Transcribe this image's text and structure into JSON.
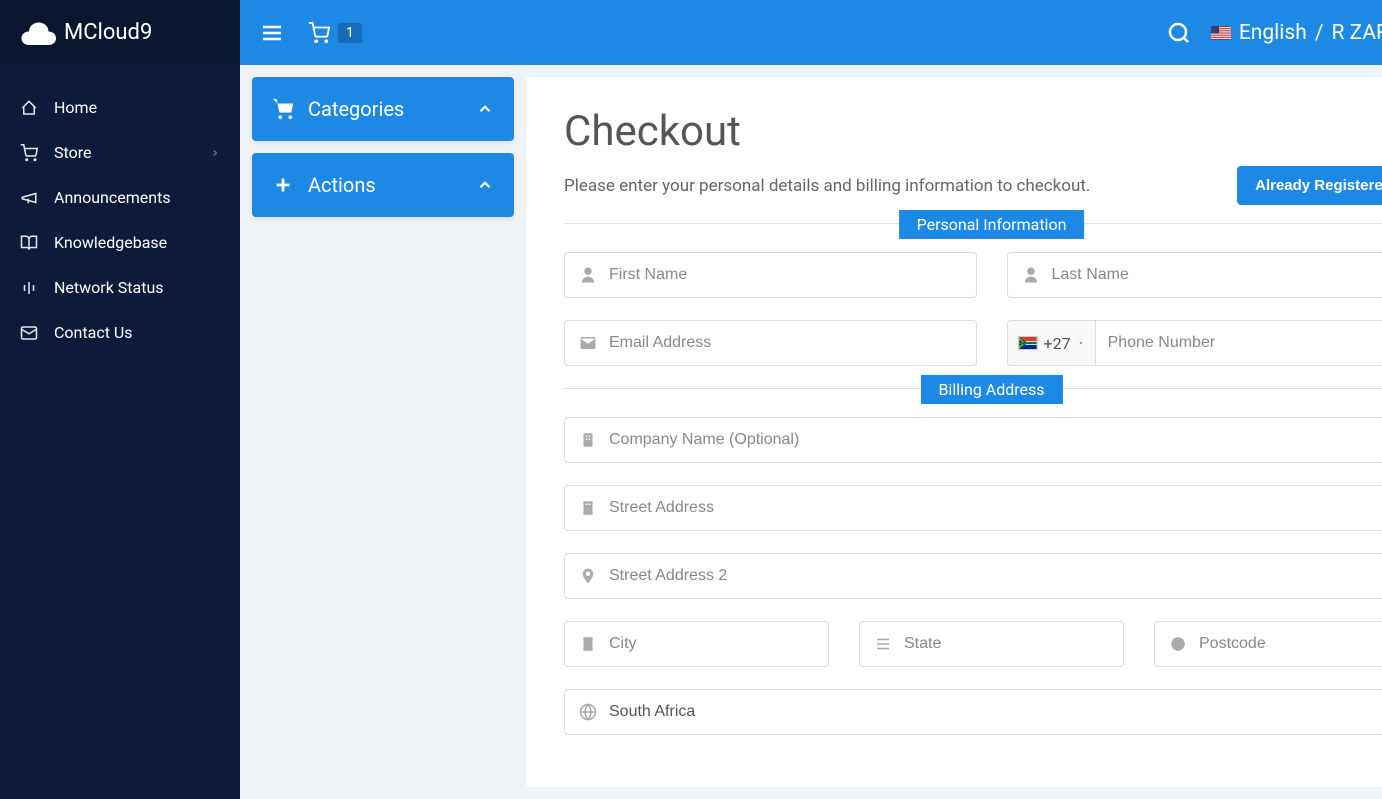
{
  "brand": {
    "name": "MCloud9"
  },
  "sidebar": {
    "items": [
      {
        "label": "Home"
      },
      {
        "label": "Store"
      },
      {
        "label": "Announcements"
      },
      {
        "label": "Knowledgebase"
      },
      {
        "label": "Network Status"
      },
      {
        "label": "Contact Us"
      }
    ]
  },
  "topbar": {
    "cart_count": "1",
    "language": "English",
    "currency": "R ZAR"
  },
  "panels": {
    "categories": "Categories",
    "actions": "Actions"
  },
  "page": {
    "title": "Checkout",
    "desc": "Please enter your personal details and billing information to checkout.",
    "already_btn": "Already Registered?"
  },
  "sections": {
    "personal": "Personal Information",
    "billing": "Billing Address"
  },
  "fields": {
    "first_name": "First Name",
    "last_name": "Last Name",
    "email": "Email Address",
    "phone": "Phone Number",
    "phone_prefix": "+27",
    "company": "Company Name (Optional)",
    "street1": "Street Address",
    "street2": "Street Address 2",
    "city": "City",
    "state": "State",
    "postcode": "Postcode",
    "country": "South Africa"
  }
}
